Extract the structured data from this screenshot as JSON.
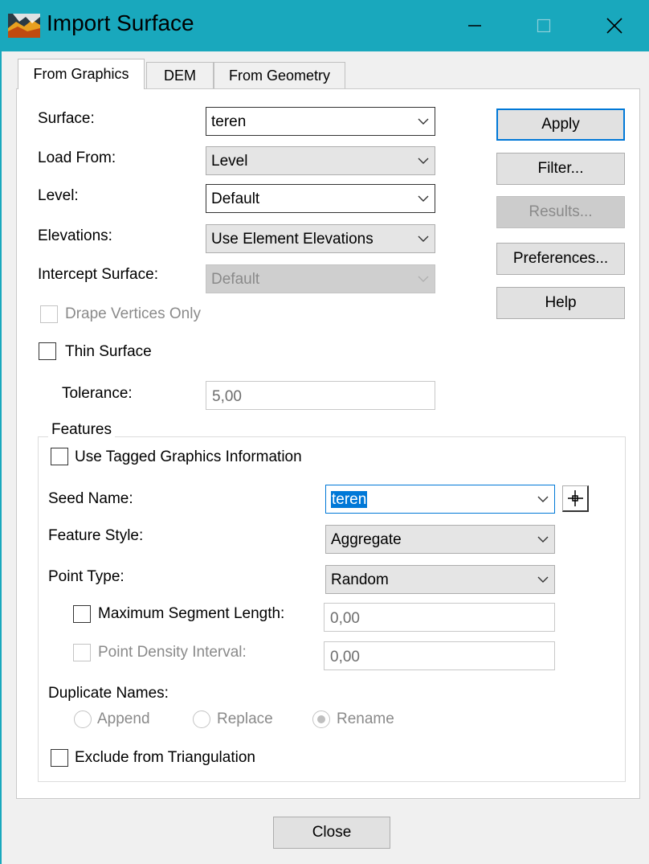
{
  "window": {
    "title": "Import Surface",
    "accent": "#19a8bd"
  },
  "tabs": [
    {
      "label": "From Graphics",
      "active": true
    },
    {
      "label": "DEM",
      "active": false
    },
    {
      "label": "From Geometry",
      "active": false
    }
  ],
  "form": {
    "surface": {
      "label": "Surface:",
      "value": "teren"
    },
    "load_from": {
      "label": "Load From:",
      "value": "Level"
    },
    "level": {
      "label": "Level:",
      "value": "Default"
    },
    "elevations": {
      "label": "Elevations:",
      "value": "Use Element Elevations"
    },
    "intercept_surface": {
      "label": "Intercept Surface:",
      "value": "Default",
      "disabled": true
    },
    "drape_vertices_only": {
      "label": "Drape Vertices Only",
      "checked": false,
      "disabled": true
    },
    "thin_surface": {
      "label": "Thin Surface",
      "checked": false
    },
    "tolerance": {
      "label": "Tolerance:",
      "value": "5,00",
      "disabled": true
    }
  },
  "buttons": {
    "apply": "Apply",
    "filter": "Filter...",
    "results": "Results...",
    "preferences": "Preferences...",
    "help": "Help",
    "close": "Close"
  },
  "features": {
    "legend": "Features",
    "use_tagged": {
      "label": "Use Tagged Graphics Information",
      "checked": false
    },
    "seed_name": {
      "label": "Seed Name:",
      "value": "teren"
    },
    "feature_style": {
      "label": "Feature Style:",
      "value": "Aggregate"
    },
    "point_type": {
      "label": "Point Type:",
      "value": "Random"
    },
    "max_segment_length": {
      "label": "Maximum Segment Length:",
      "value": "0,00",
      "checked": false
    },
    "point_density_interval": {
      "label": "Point Density Interval:",
      "value": "0,00",
      "checked": false,
      "disabled": true
    },
    "duplicate_names": {
      "label": "Duplicate Names:",
      "options": [
        {
          "label": "Append",
          "selected": false
        },
        {
          "label": "Replace",
          "selected": false
        },
        {
          "label": "Rename",
          "selected": true
        }
      ]
    },
    "exclude_from_triangulation": {
      "label": "Exclude from Triangulation",
      "checked": false
    }
  },
  "icons": {
    "app": "surface-app-icon",
    "minimize": "minimize-icon",
    "maximize": "maximize-icon",
    "close": "close-icon",
    "pick": "crosshair-pick-icon"
  }
}
